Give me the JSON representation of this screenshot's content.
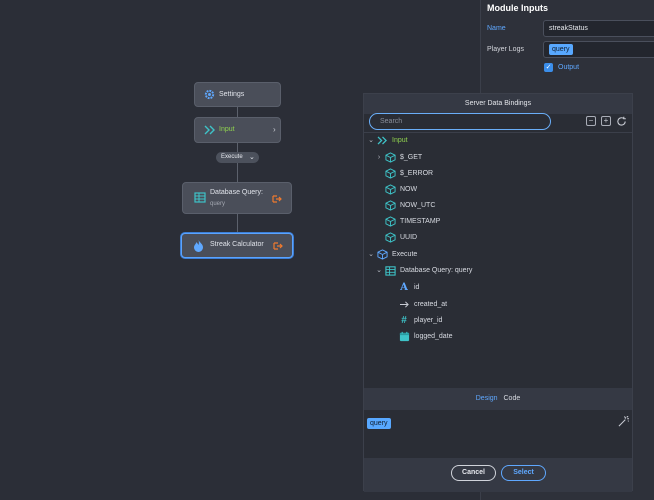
{
  "module_inputs": {
    "title": "Module Inputs",
    "name_label": "Name",
    "name_value": "streakStatus",
    "player_logs_label": "Player Logs",
    "player_logs_chip": "query",
    "output_label": "Output",
    "output_checked": true
  },
  "flow": {
    "settings_label": "Settings",
    "input_label": "Input",
    "execute_label": "Execute",
    "db_query_label": "Database Query:",
    "db_query_sub": "query",
    "streak_label": "Streak Calculator"
  },
  "dialog": {
    "title": "Server Data Bindings",
    "search_placeholder": "Search",
    "tree": {
      "input": "Input",
      "get": "$_GET",
      "error": "$_ERROR",
      "now": "NOW",
      "now_utc": "NOW_UTC",
      "timestamp": "TIMESTAMP",
      "uuid": "UUID",
      "execute": "Execute",
      "db_query": "Database Query: query",
      "id": "id",
      "created_at": "created_at",
      "player_id": "player_id",
      "logged_date": "logged_date"
    },
    "tabs": {
      "design": "Design",
      "code": "Code"
    },
    "code_chip": "query",
    "cancel_label": "Cancel",
    "select_label": "Select"
  },
  "colors": {
    "accent": "#5fa8ff",
    "cube": "#3ec3c8",
    "execute_icon": "#5fa8ff",
    "orange": "#f07a2e"
  }
}
